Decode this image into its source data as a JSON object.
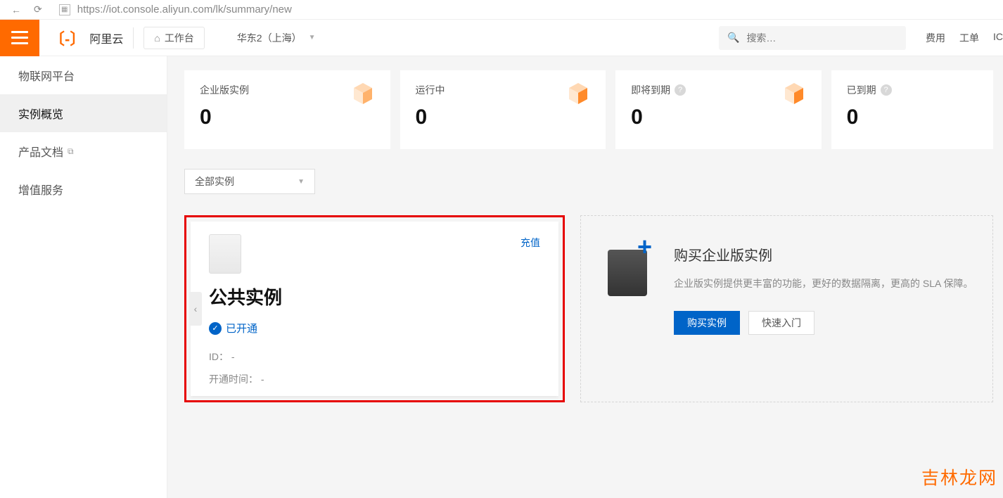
{
  "browser": {
    "url": "https://iot.console.aliyun.com/lk/summary/new"
  },
  "header": {
    "brand": "阿里云",
    "workspace": "工作台",
    "region": "华东2（上海）",
    "search_placeholder": "搜索…",
    "links": [
      "费用",
      "工单",
      "IC"
    ]
  },
  "sidebar": {
    "items": [
      {
        "label": "物联网平台",
        "active": false,
        "external": false
      },
      {
        "label": "实例概览",
        "active": true,
        "external": false
      },
      {
        "label": "产品文档",
        "active": false,
        "external": true
      },
      {
        "label": "增值服务",
        "active": false,
        "external": false
      }
    ]
  },
  "stats": [
    {
      "title": "企业版实例",
      "value": "0",
      "help": false,
      "accent": "#ff6a00"
    },
    {
      "title": "运行中",
      "value": "0",
      "help": false,
      "accent": "#ff6a00"
    },
    {
      "title": "即将到期",
      "value": "0",
      "help": true,
      "accent": "#ff6a00"
    },
    {
      "title": "已到期",
      "value": "0",
      "help": true,
      "accent": null
    }
  ],
  "filter": {
    "selected": "全部实例"
  },
  "instance": {
    "recharge": "充值",
    "name": "公共实例",
    "status": "已开通",
    "id_label": "ID：",
    "id_value": "-",
    "time_label": "开通时间：",
    "time_value": "-"
  },
  "promo": {
    "title": "购买企业版实例",
    "desc": "企业版实例提供更丰富的功能，更好的数据隔离，更高的 SLA 保障。",
    "buy": "购买实例",
    "guide": "快速入门"
  },
  "watermark": "吉林龙网"
}
